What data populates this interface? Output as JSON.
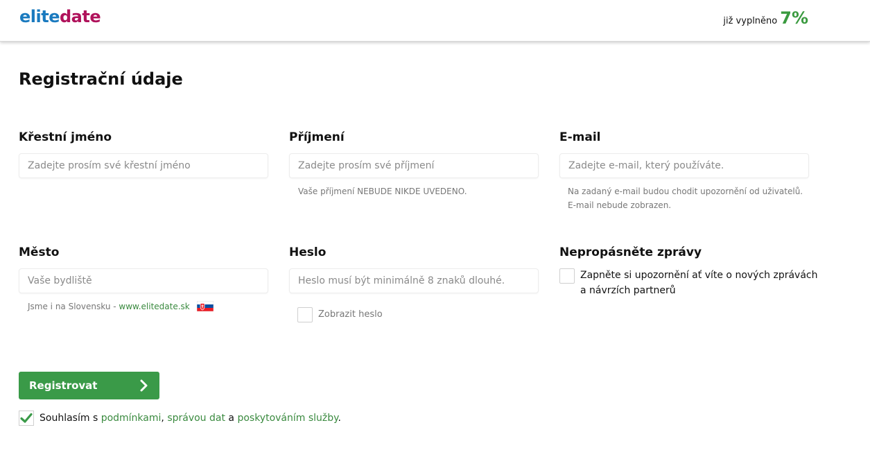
{
  "header": {
    "logo_elite": "elite",
    "logo_date": "date",
    "progress_label": "již vyplněno",
    "progress_value": "7%"
  },
  "page": {
    "title": "Registrační údaje"
  },
  "form": {
    "first_name": {
      "label": "Křestní jméno",
      "placeholder": "Zadejte prosím své křestní jméno",
      "value": ""
    },
    "last_name": {
      "label": "Příjmení",
      "placeholder": "Zadejte prosím své příjmení",
      "value": "",
      "hint": "Vaše příjmení NEBUDE NIKDE UVEDENO."
    },
    "email": {
      "label": "E-mail",
      "placeholder": "Zadejte e-mail, který používáte.",
      "value": "",
      "hint_line1": "Na zadaný e-mail budou chodit upozornění od uživatelů.",
      "hint_line2": "E-mail nebude zobrazen."
    },
    "city": {
      "label": "Město",
      "placeholder": "Vaše bydliště",
      "value": "",
      "hint_text": "Jsme i na Slovensku - ",
      "hint_link": "www.elitedate.sk"
    },
    "password": {
      "label": "Heslo",
      "placeholder": "Heslo musí být minimálně 8 znaků dlouhé.",
      "value": "",
      "show_password_label": "Zobrazit heslo",
      "show_password_checked": false
    },
    "notifications": {
      "label": "Nepropásněte zprávy",
      "checkbox_line1": "Zapněte si upozornění ať víte o nových zprávách",
      "checkbox_line2": "a návrzích partnerů",
      "checked": false
    }
  },
  "actions": {
    "register_label": "Registrovat",
    "agree_checked": true,
    "agree_prefix": "Souhlasím s ",
    "agree_link1": "podmínkami",
    "agree_sep1": ", ",
    "agree_link2": "správou dat",
    "agree_sep2": " a ",
    "agree_link3": "poskytováním služby",
    "agree_suffix": "."
  },
  "colors": {
    "brand_blue": "#1a7abf",
    "brand_magenta": "#b0125b",
    "accent_green": "#3a9a48",
    "link_green": "#3a8a3f"
  }
}
